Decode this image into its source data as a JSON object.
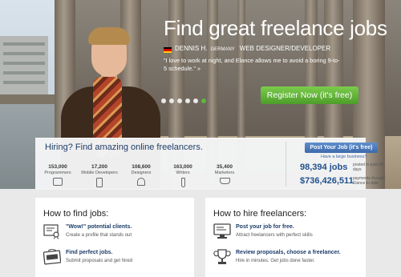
{
  "hero": {
    "headline": "Find great freelance jobs",
    "freelancer_name": "DENNIS H.",
    "freelancer_country": "GERMANY",
    "freelancer_role": "WEB DESIGNER/DEVELOPER",
    "quote": "\"I love to work at night, and Elance allows me to avoid a boring 9-to-5 schedule.\" »",
    "register_label": "Register Now (it's free)",
    "slide_count": 6,
    "active_slide": 6
  },
  "hiring": {
    "title": "Hiring? Find amazing online freelancers.",
    "categories": [
      {
        "count": "153,000",
        "label": "Programmers",
        "icon": "programmer-icon"
      },
      {
        "count": "17,200",
        "label": "Mobile Developers",
        "icon": "mobile-icon"
      },
      {
        "count": "108,600",
        "label": "Designers",
        "icon": "designer-icon"
      },
      {
        "count": "163,000",
        "label": "Writers",
        "icon": "writer-icon"
      },
      {
        "count": "35,400",
        "label": "Marketers",
        "icon": "marketer-icon"
      }
    ],
    "post_job_label": "Post Your Job (it's free)",
    "large_business_link": "Have a large business?",
    "jobs_count": "98,394 jobs",
    "jobs_caption": "posted in past 30 days",
    "payments_amount": "$736,426,511",
    "payments_caption": "payments through Elance to date"
  },
  "how_find": {
    "title": "How to find jobs:",
    "items": [
      {
        "title": "\"Wow!\" potential clients.",
        "desc": "Create a profile that stands out",
        "icon": "certificate-icon"
      },
      {
        "title": "Find perfect jobs.",
        "desc": "Submit proposals and get hired",
        "icon": "hired-sign-icon"
      }
    ]
  },
  "how_hire": {
    "title": "How to hire freelancers:",
    "items": [
      {
        "title": "Post your job for free.",
        "desc": "Attract freelancers with perfect skills",
        "icon": "monitor-icon"
      },
      {
        "title": "Review proposals, choose a freelancer.",
        "desc": "Hire in minutes. Get jobs done faster.",
        "icon": "trophy-icon"
      }
    ]
  },
  "colors": {
    "accent_green": "#5cb63d",
    "brand_blue": "#1d4f8f",
    "headline_text": "#ffffff"
  }
}
